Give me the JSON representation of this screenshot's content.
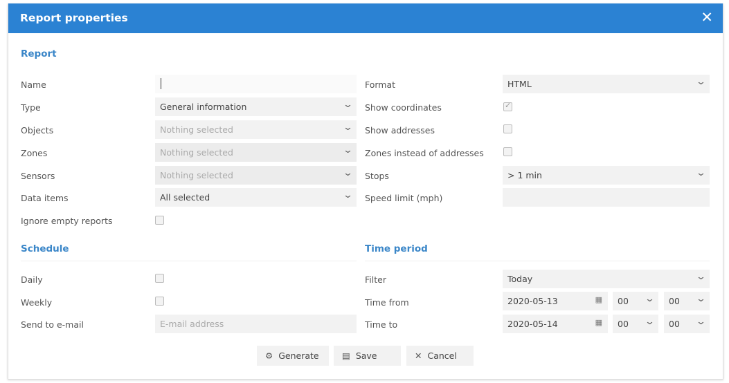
{
  "dialog": {
    "title": "Report properties",
    "close_icon": "close-icon"
  },
  "report": {
    "heading": "Report",
    "name": {
      "label": "Name",
      "value": ""
    },
    "type": {
      "label": "Type",
      "value": "General information"
    },
    "objects": {
      "label": "Objects",
      "value": "Nothing selected"
    },
    "zones": {
      "label": "Zones",
      "value": "Nothing selected"
    },
    "sensors": {
      "label": "Sensors",
      "value": "Nothing selected"
    },
    "data_items": {
      "label": "Data items",
      "value": "All selected"
    },
    "ignore_empty": {
      "label": "Ignore empty reports",
      "checked": false
    },
    "format": {
      "label": "Format",
      "value": "HTML"
    },
    "show_coordinates": {
      "label": "Show coordinates",
      "checked": true
    },
    "show_addresses": {
      "label": "Show addresses",
      "checked": false
    },
    "zones_instead": {
      "label": "Zones instead of addresses",
      "checked": false
    },
    "stops": {
      "label": "Stops",
      "value": "> 1 min"
    },
    "speed_limit": {
      "label": "Speed limit (mph)",
      "value": ""
    }
  },
  "schedule": {
    "heading": "Schedule",
    "daily": {
      "label": "Daily",
      "checked": false
    },
    "weekly": {
      "label": "Weekly",
      "checked": false
    },
    "email": {
      "label": "Send to e-mail",
      "placeholder": "E-mail address"
    }
  },
  "time_period": {
    "heading": "Time period",
    "filter": {
      "label": "Filter",
      "value": "Today"
    },
    "from": {
      "label": "Time from",
      "date": "2020-05-13",
      "hour": "00",
      "minute": "00"
    },
    "to": {
      "label": "Time to",
      "date": "2020-05-14",
      "hour": "00",
      "minute": "00"
    }
  },
  "buttons": {
    "generate": "Generate",
    "save": "Save",
    "cancel": "Cancel"
  }
}
